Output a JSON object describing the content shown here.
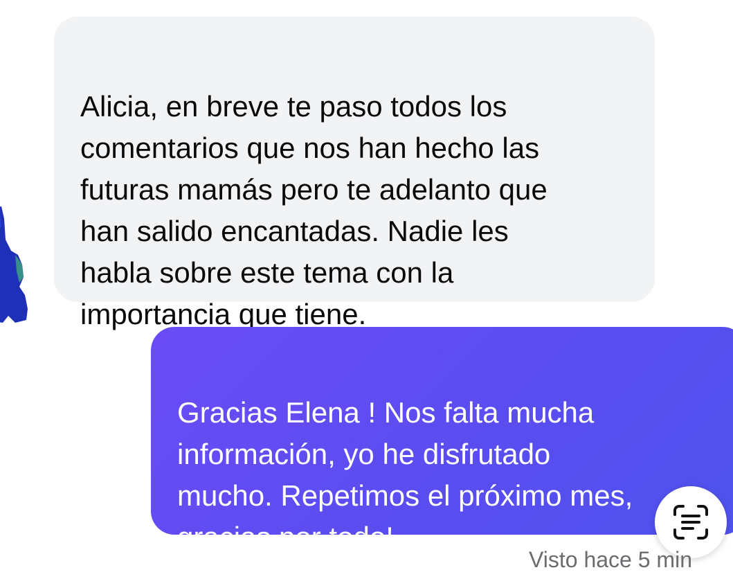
{
  "conversation": {
    "incoming": {
      "text": "Alicia, en breve te paso todos los\ncomentarios que nos han hecho las\nfuturas mamás pero te adelanto que\nhan salido encantadas. Nadie les\nhabla sobre este tema con la\nimportancia que tiene."
    },
    "outgoing": {
      "text": "Gracias Elena ! Nos falta mucha\ninformación, yo he disfrutado\nmucho. Repetimos el próximo mes,\ngracias por todo!"
    },
    "status": "Visto hace 5 min"
  },
  "icons": {
    "avatar": "avatar",
    "scan": "live-text-scan-icon"
  },
  "colors": {
    "incoming_bubble": "#f2f3f5",
    "outgoing_bubble": "#5a4df0",
    "status_text": "#6b6b70",
    "avatar_blue": "#1e2fb8"
  }
}
